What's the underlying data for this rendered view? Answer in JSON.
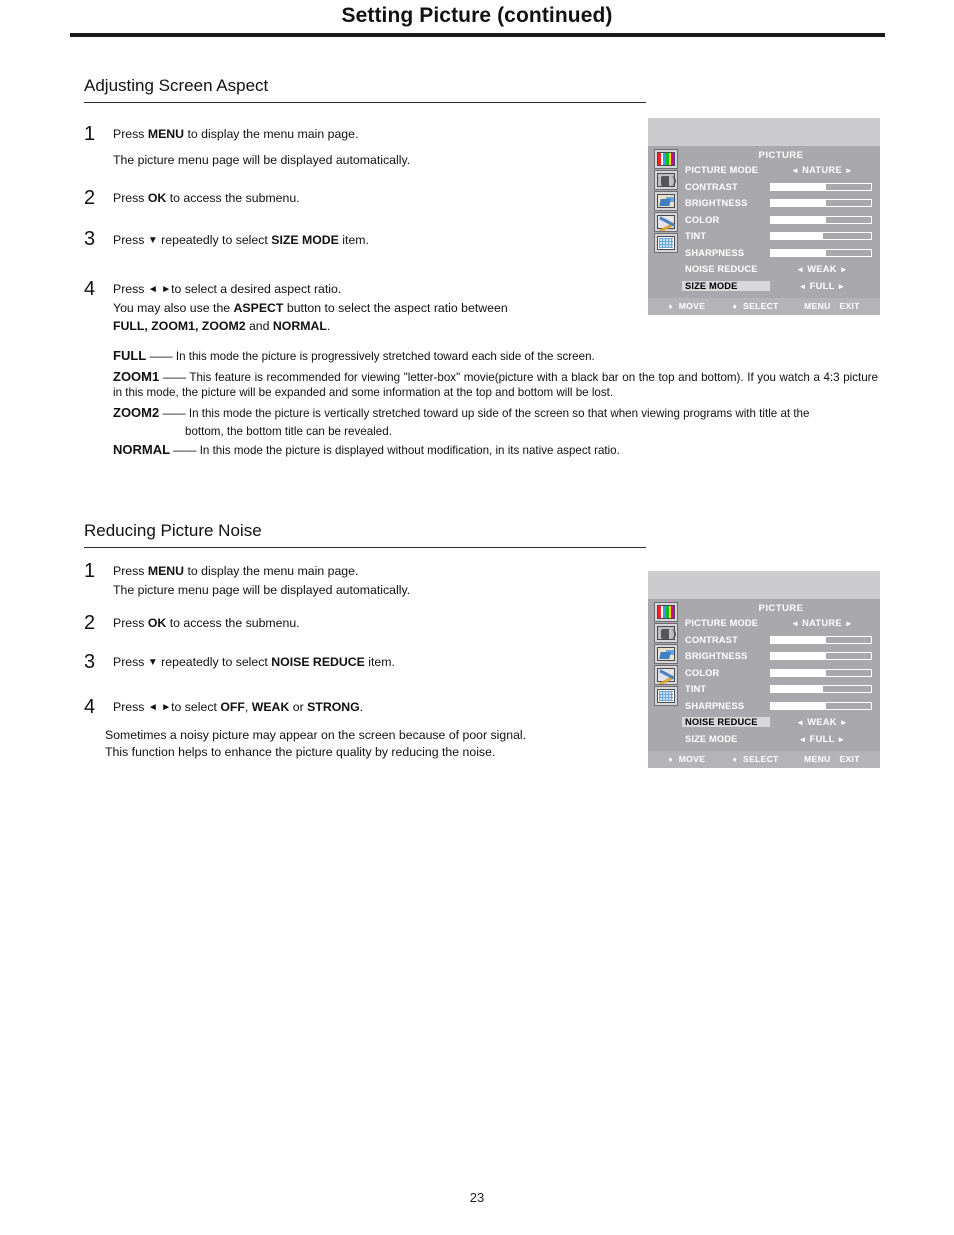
{
  "page": {
    "title": "Setting Picture (continued)",
    "number": "23"
  },
  "sections": [
    {
      "heading": "Adjusting Screen Aspect",
      "steps": [
        {
          "num": "1",
          "line1_a": "Press ",
          "line1_b": "MENU",
          "line1_c": " to display the menu main page.",
          "line2": "The picture menu page will be displayed automatically."
        },
        {
          "num": "2",
          "line1_a": "Press ",
          "line1_b": "OK",
          "line1_c": " to access the submenu."
        },
        {
          "num": "3",
          "line1_a": "Press ",
          "glyph": "▼",
          "line1_c": " repeatedly to select ",
          "line1_b": "SIZE MODE",
          "line1_d": " item."
        },
        {
          "num": "4",
          "line1_a": "Press ",
          "glyph_left": "◄",
          "glyph_right": "►",
          "line1_c": "to select a desired aspect ratio.",
          "line2_a": "You may also use the ",
          "line2_b": "ASPECT",
          "line2_c": " button to select the aspect ratio between",
          "line3_a": "FULL, ZOOM1, ZOOM2",
          "line3_b": " and ",
          "line3_c": "NORMAL",
          "line3_d": "."
        }
      ],
      "definitions": [
        {
          "term": "FULL",
          "dash": " —— ",
          "text": "In this mode the picture is progressively stretched toward each side of the screen."
        },
        {
          "term": "ZOOM1",
          "dash": " —— ",
          "text": "This feature is recommended for viewing \"letter-box\" movie(picture with a black bar on the top and bottom). If you watch a 4:3 picture in this mode, the picture will be expanded and some information at the top and bottom will be lost."
        },
        {
          "term": "ZOOM2",
          "dash": " —— ",
          "text": "In this mode the picture is vertically stretched toward up side of the screen so that when viewing programs with title at the",
          "text2": "bottom, the bottom title can be revealed."
        },
        {
          "term": "NORMAL",
          "dash": " —— ",
          "text": "In this mode the picture is displayed without modification, in its native aspect ratio."
        }
      ]
    },
    {
      "heading": "Reducing Picture Noise",
      "steps": [
        {
          "num": "1",
          "line1_a": "Press ",
          "line1_b": "MENU",
          "line1_c": " to display the menu main page.",
          "line2": "The picture menu page will be displayed automatically."
        },
        {
          "num": "2",
          "line1_a": "Press ",
          "line1_b": "OK",
          "line1_c": " to access the submenu."
        },
        {
          "num": "3",
          "line1_a": "Press ",
          "glyph": "▼",
          "line1_c": " repeatedly to select ",
          "line1_b": "NOISE REDUCE",
          "line1_d": " item."
        },
        {
          "num": "4",
          "line1_a": "Press ",
          "glyph_left": "◄",
          "glyph_right": "►",
          "line1_c": "to select  ",
          "opt1": "OFF",
          "sep1": ", ",
          "opt2": "WEAK",
          "sep2": " or ",
          "opt3": "STRONG",
          "end": "."
        }
      ],
      "note": {
        "line1": "Sometimes a noisy picture may appear on the screen because of poor signal.",
        "line2": "This function helps to enhance the picture quality by reducing the noise."
      }
    }
  ],
  "osd": {
    "title": "PICTURE",
    "icons": [
      {
        "name": "picture-bars-icon"
      },
      {
        "name": "sound-speaker-icon"
      },
      {
        "name": "setup-hand-icon"
      },
      {
        "name": "function-tools-icon"
      },
      {
        "name": "screen-grid-icon"
      }
    ],
    "rows_top": [
      {
        "label": "PICTURE MODE",
        "type": "option",
        "left": "◄",
        "value": "NATURE",
        "right": "►",
        "selected": false
      },
      {
        "label": "CONTRAST",
        "type": "bar",
        "fill": 55,
        "selected": false
      },
      {
        "label": "BRIGHTNESS",
        "type": "bar",
        "fill": 55,
        "selected": false
      },
      {
        "label": "COLOR",
        "type": "bar",
        "fill": 55,
        "selected": false
      },
      {
        "label": "TINT",
        "type": "bar",
        "fill": 52,
        "selected": false
      },
      {
        "label": "SHARPNESS",
        "type": "bar",
        "fill": 55,
        "selected": false
      },
      {
        "label": "NOISE REDUCE",
        "type": "option",
        "left": "◄",
        "value": "WEAK",
        "right": "►",
        "selected": false
      },
      {
        "label": "SIZE MODE",
        "type": "option",
        "left": "◄",
        "value": "FULL",
        "right": "►",
        "selected": true
      }
    ],
    "rows_bottom": [
      {
        "label": "PICTURE MODE",
        "type": "option",
        "left": "◄",
        "value": "NATURE",
        "right": "►",
        "selected": false
      },
      {
        "label": "CONTRAST",
        "type": "bar",
        "fill": 55,
        "selected": false
      },
      {
        "label": "BRIGHTNESS",
        "type": "bar",
        "fill": 55,
        "selected": false
      },
      {
        "label": "COLOR",
        "type": "bar",
        "fill": 55,
        "selected": false
      },
      {
        "label": "TINT",
        "type": "bar",
        "fill": 52,
        "selected": false
      },
      {
        "label": "SHARPNESS",
        "type": "bar",
        "fill": 55,
        "selected": false
      },
      {
        "label": "NOISE REDUCE",
        "type": "option",
        "left": "◄",
        "value": "WEAK",
        "right": "►",
        "selected": true
      },
      {
        "label": "SIZE MODE",
        "type": "option",
        "left": "◄",
        "value": "FULL",
        "right": "►",
        "selected": false
      }
    ],
    "footer": {
      "move_glyph": "♦",
      "move": "MOVE",
      "select_glyph": "♦",
      "select": "SELECT",
      "menu": "MENU",
      "exit": "EXIT"
    },
    "colors": {
      "panel_bg": "#a9a9ad",
      "top_strip": "#cccccf",
      "footer_bg": "#b4b4b8",
      "highlight": "#d8d8da",
      "text": "#ffffff"
    },
    "bar_colors": [
      "#ff0000",
      "#ffffff",
      "#00a0ff",
      "#00c000",
      "#ffd000",
      "#ff00b0"
    ]
  }
}
